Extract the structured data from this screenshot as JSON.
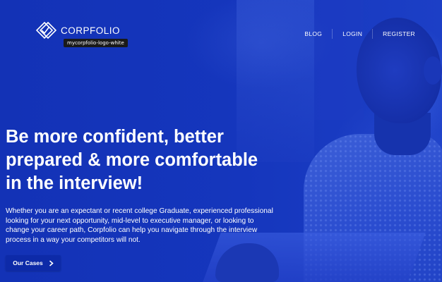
{
  "header": {
    "logo_text": "CORPFOLIO",
    "logo_tooltip": "mycorpfolio-logo-white",
    "nav": [
      {
        "label": "BLOG"
      },
      {
        "label": "LOGIN"
      },
      {
        "label": "REGISTER"
      }
    ]
  },
  "hero": {
    "headline_lines": [
      "Be more confident, better",
      "prepared & more comfortable",
      "in the interview!"
    ],
    "subcopy_lines": [
      "Whether you are an expectant or recent college Graduate, experienced professional",
      "looking for your next opportunity, mid-level to executive manager, or looking to",
      "change your career path, Corpfolio can help you navigate through the interview",
      "process in a way your competitors will not."
    ],
    "cta_label": "Our Cases",
    "cta_icon": "chevron-right-icon"
  },
  "colors": {
    "background": "#1433b8",
    "cta_background": "#0d2aa8",
    "text": "#ffffff"
  }
}
